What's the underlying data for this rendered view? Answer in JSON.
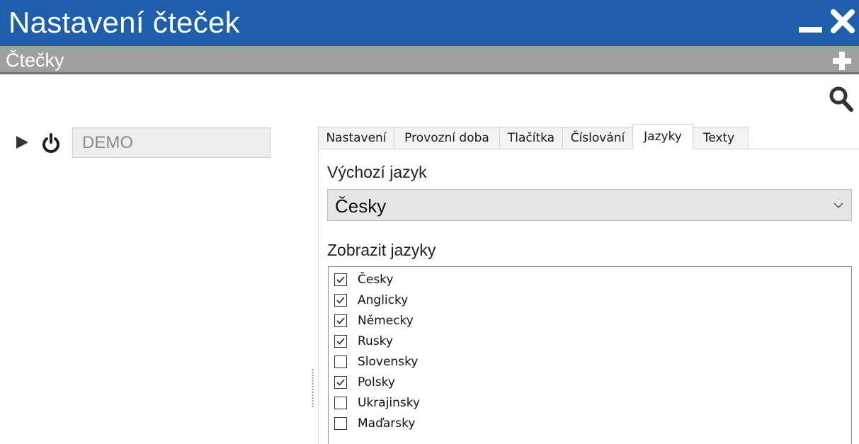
{
  "window": {
    "title": "Nastavení čteček"
  },
  "section": {
    "title": "Čtečky"
  },
  "reader": {
    "name": "DEMO"
  },
  "tabs": [
    {
      "label": "Nastavení",
      "active": false
    },
    {
      "label": "Provozní doba",
      "active": false
    },
    {
      "label": "Tlačítka",
      "active": false
    },
    {
      "label": "Číslování",
      "active": false
    },
    {
      "label": "Jazyky",
      "active": true
    },
    {
      "label": "Texty",
      "active": false
    }
  ],
  "languages_panel": {
    "default_language_label": "Výchozí jazyk",
    "default_language_value": "Česky",
    "show_languages_label": "Zobrazit jazyky",
    "languages": [
      {
        "label": "Česky",
        "checked": true
      },
      {
        "label": "Anglicky",
        "checked": true
      },
      {
        "label": "Německy",
        "checked": true
      },
      {
        "label": "Rusky",
        "checked": true
      },
      {
        "label": "Slovensky",
        "checked": false
      },
      {
        "label": "Polsky",
        "checked": true
      },
      {
        "label": "Ukrajinsky",
        "checked": false
      },
      {
        "label": "Maďarsky",
        "checked": false
      }
    ]
  },
  "icons": {
    "minimize": "minimize-icon",
    "close": "close-icon",
    "add": "plus-icon",
    "search": "search-icon",
    "expand": "play-triangle-icon",
    "power": "power-icon",
    "dropdown": "chevron-down-icon",
    "check": "checkmark-icon"
  },
  "colors": {
    "titlebar": "#1e5ead",
    "subbar": "#a0a0a0"
  }
}
